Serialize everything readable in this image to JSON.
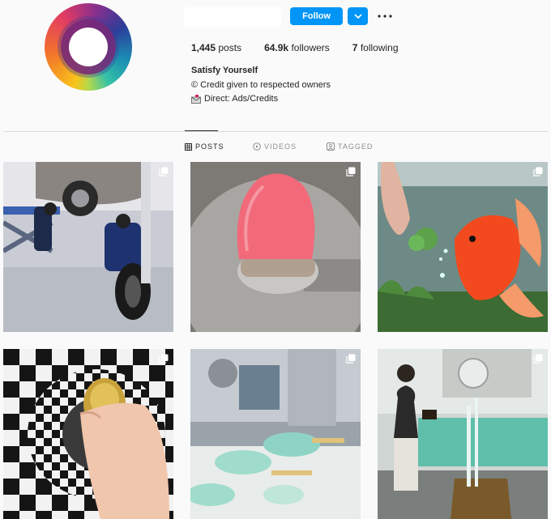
{
  "profile": {
    "username": "",
    "follow_label": "Follow",
    "stats": {
      "posts_count": "1,445",
      "posts_label": "posts",
      "followers_count": "64.9k",
      "followers_label": "followers",
      "following_count": "7",
      "following_label": "following"
    },
    "bio": {
      "name": "Satisfy Yourself",
      "line1": "© Credit given to respected owners",
      "line2": "Direct: Ads/Credits"
    }
  },
  "tabs": [
    {
      "label": "POSTS",
      "icon": "grid-icon",
      "active": true
    },
    {
      "label": "VIDEOS",
      "icon": "video-icon",
      "active": false
    },
    {
      "label": "TAGGED",
      "icon": "tag-icon",
      "active": false
    }
  ],
  "posts": [
    {
      "subject": "car-lift-tire-workers",
      "multi": true
    },
    {
      "subject": "pink-sponge-machine",
      "multi": true
    },
    {
      "subject": "goldfish-broccoli",
      "multi": true
    },
    {
      "subject": "checkered-tunnel-hand",
      "multi": true
    },
    {
      "subject": "green-ice-cream-molds",
      "multi": true
    },
    {
      "subject": "man-fountain-book",
      "multi": true
    }
  ],
  "colors": {
    "accent": "#0095f6",
    "background": "#fafafa",
    "text": "#262626",
    "muted": "#8e8e8e"
  }
}
